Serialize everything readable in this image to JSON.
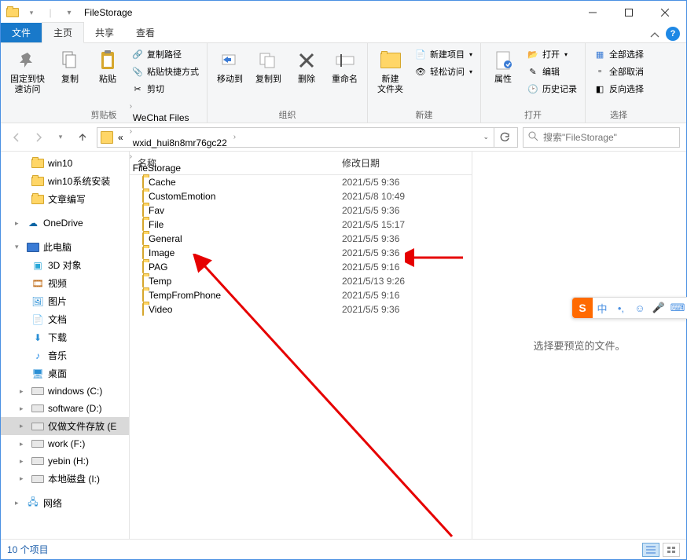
{
  "titlebar": {
    "title": "FileStorage"
  },
  "tabs": {
    "file": "文件",
    "home": "主页",
    "share": "共享",
    "view": "查看"
  },
  "ribbon": {
    "pin": "固定到快\n速访问",
    "copy": "复制",
    "paste": "粘贴",
    "copy_path": "复制路径",
    "paste_shortcut": "粘贴快捷方式",
    "cut": "剪切",
    "clipboard_group": "剪贴板",
    "move_to": "移动到",
    "copy_to": "复制到",
    "delete": "删除",
    "rename": "重命名",
    "organize_group": "组织",
    "new_folder": "新建\n文件夹",
    "new_item": "新建项目",
    "easy_access": "轻松访问",
    "new_group": "新建",
    "properties": "属性",
    "open": "打开",
    "edit": "编辑",
    "history": "历史记录",
    "open_group": "打开",
    "select_all": "全部选择",
    "select_none": "全部取消",
    "invert": "反向选择",
    "select_group": "选择"
  },
  "breadcrumb": {
    "prefix": "«",
    "items": [
      "WeChat Files",
      "wxid_hui8n8mr76gc22",
      "FileStorage"
    ]
  },
  "search": {
    "placeholder": "搜索\"FileStorage\""
  },
  "sidebar": {
    "items": [
      {
        "label": "win10",
        "icon": "folder",
        "level": 1
      },
      {
        "label": "win10系统安装",
        "icon": "folder",
        "level": 1
      },
      {
        "label": "文章编写",
        "icon": "folder",
        "level": 1
      },
      {
        "spacer": true
      },
      {
        "label": "OneDrive",
        "icon": "onedrive",
        "level": 0,
        "exp": "▸"
      },
      {
        "spacer": true
      },
      {
        "label": "此电脑",
        "icon": "pc",
        "level": 0,
        "exp": "▾"
      },
      {
        "label": "3D 对象",
        "icon": "3d",
        "level": 1
      },
      {
        "label": "视频",
        "icon": "video",
        "level": 1
      },
      {
        "label": "图片",
        "icon": "pic",
        "level": 1
      },
      {
        "label": "文档",
        "icon": "doc",
        "level": 1
      },
      {
        "label": "下载",
        "icon": "download",
        "level": 1
      },
      {
        "label": "音乐",
        "icon": "music",
        "level": 1
      },
      {
        "label": "桌面",
        "icon": "desktop",
        "level": 1
      },
      {
        "label": "windows (C:)",
        "icon": "drive",
        "level": 1,
        "exp": "▸"
      },
      {
        "label": "software (D:)",
        "icon": "drive",
        "level": 1,
        "exp": "▸"
      },
      {
        "label": "仅做文件存放 (E",
        "icon": "drive",
        "level": 1,
        "exp": "▸",
        "selected": true
      },
      {
        "label": "work (F:)",
        "icon": "drive",
        "level": 1,
        "exp": "▸"
      },
      {
        "label": "yebin (H:)",
        "icon": "drive",
        "level": 1,
        "exp": "▸"
      },
      {
        "label": "本地磁盘 (I:)",
        "icon": "drive",
        "level": 1,
        "exp": "▸"
      },
      {
        "spacer": true
      },
      {
        "label": "网络",
        "icon": "network",
        "level": 0,
        "exp": "▸"
      }
    ]
  },
  "columns": {
    "name": "名称",
    "date": "修改日期"
  },
  "files": [
    {
      "name": "Cache",
      "date": "2021/5/5 9:36"
    },
    {
      "name": "CustomEmotion",
      "date": "2021/5/8 10:49"
    },
    {
      "name": "Fav",
      "date": "2021/5/5 9:36"
    },
    {
      "name": "File",
      "date": "2021/5/5 15:17"
    },
    {
      "name": "General",
      "date": "2021/5/5 9:36"
    },
    {
      "name": "Image",
      "date": "2021/5/5 9:36"
    },
    {
      "name": "PAG",
      "date": "2021/5/5 9:16"
    },
    {
      "name": "Temp",
      "date": "2021/5/13 9:26"
    },
    {
      "name": "TempFromPhone",
      "date": "2021/5/5 9:16"
    },
    {
      "name": "Video",
      "date": "2021/5/5 9:36"
    }
  ],
  "preview": {
    "empty": "选择要预览的文件。"
  },
  "status": {
    "count": "10 个项目"
  },
  "ime": {
    "zhong": "中"
  }
}
